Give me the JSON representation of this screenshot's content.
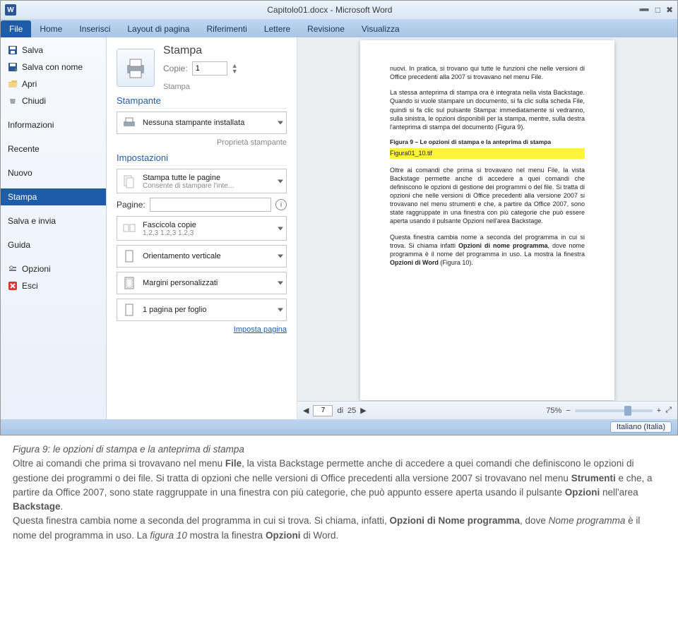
{
  "title_bar": {
    "app_icon": "W",
    "window_title": "Capitolo01.docx - Microsoft Word"
  },
  "tabs": {
    "file": "File",
    "home": "Home",
    "inserisci": "Inserisci",
    "layout": "Layout di pagina",
    "riferimenti": "Riferimenti",
    "lettere": "Lettere",
    "revisione": "Revisione",
    "visualizza": "Visualizza"
  },
  "backstage_menu": {
    "salva": "Salva",
    "salva_come": "Salva con nome",
    "apri": "Apri",
    "chiudi": "Chiudi",
    "informazioni": "Informazioni",
    "recente": "Recente",
    "nuovo": "Nuovo",
    "stampa": "Stampa",
    "salva_invia": "Salva e invia",
    "guida": "Guida",
    "opzioni": "Opzioni",
    "esci": "Esci"
  },
  "print": {
    "header": "Stampa",
    "stampa_btn": "Stampa",
    "copie_label": "Copie:",
    "copie_value": "1",
    "stampante_h": "Stampante",
    "stampante_main": "Nessuna stampante installata",
    "stampante_prop": "Proprietà stampante",
    "impostazioni_h": "Impostazioni",
    "scope_main": "Stampa tutte le pagine",
    "scope_sub": "Consente di stampare l'inte...",
    "pagine_label": "Pagine:",
    "pagine_value": "",
    "collate_main": "Fascicola copie",
    "collate_sub": "1,2,3   1,2,3   1,2,3",
    "orient_main": "Orientamento verticale",
    "margins_main": "Margini personalizzati",
    "sheets_main": "1 pagina per foglio",
    "page_setup": "Imposta pagina"
  },
  "preview": {
    "para1": "nuovi. In pratica, si trovano qui tutte le funzioni che nelle versioni di Office precedenti alla 2007 si trovavano nel menu File.",
    "para2": "La stessa anteprima di stampa ora è integrata nella vista Backstage. Quando si vuole stampare un documento, si fa clic sulla scheda File, quindi si fa clic sul pulsante Stampa: immediatamente si vedranno, sulla sinistra, le opzioni disponibili per la stampa, mentre, sulla destra l'anteprima di stampa del documento (Figura 9).",
    "fig_caption": "Figura 9 – Le opzioni di stampa e la anteprima di stampa",
    "fig_highlight": "Figura01_10.tif",
    "para3": "Oltre ai comandi che prima si trovavano nel menu File, la vista Backstage permette anche di accedere a quei comandi che definiscono le opzioni di gestione dei programmi o del file. Si tratta di opzioni che nelle versioni di Office precedenti alla versione 2007 si trovavano nel menu strumenti e che, a partire da Office 2007, sono state raggruppate in una finestra con più categorie che può essere aperta usando il pulsante Opzioni nell'area Backstage.",
    "para4_1": "Questa finestra cambia nome a seconda del programma in cui si trova. Si chiama infatti ",
    "para4_b1": "Opzioni di nome programma",
    "para4_2": ", dove nome programma è il nome del programma in uso.  La mostra la finestra ",
    "para4_b2": "Opzioni di Word",
    "para4_3": " (Figura 10).",
    "page_current": "7",
    "page_sep": "di",
    "page_total": "25",
    "zoom": "75%"
  },
  "status": {
    "language": "Italiano (Italia)"
  },
  "caption": {
    "fig_label": "Figura 9: le opzioni di stampa e la anteprima di stampa",
    "p1_a": "Oltre ai comandi che prima si trovavano nel menu ",
    "p1_b1": "File",
    "p1_b": ", la vista Backstage permette anche di accedere a quei comandi che definiscono le opzioni di gestione dei programmi o dei file. Si tratta di opzioni che nelle versioni di Office precedenti alla versione 2007 si trovavano nel menu ",
    "p1_b2": "Strumenti",
    "p1_c": " e che, a partire da Office 2007, sono state raggruppate in una finestra con più categorie, che può appunto essere aperta usando il pulsante ",
    "p1_b3": "Opzioni",
    "p1_d": " nell'area ",
    "p1_b4": "Backstage",
    "p1_e": ".",
    "p2_a": "Questa finestra cambia nome a seconda del programma in cui si trova. Si chiama, infatti, ",
    "p2_b1": "Opzioni di Nome programma",
    "p2_b": ", dove ",
    "p2_i1": "Nome programma",
    "p2_c": " è il nome del programma in uso. La ",
    "p2_i2": "figura 10",
    "p2_d": " mostra la finestra ",
    "p2_b2": "Opzioni",
    "p2_e": " di Word."
  }
}
